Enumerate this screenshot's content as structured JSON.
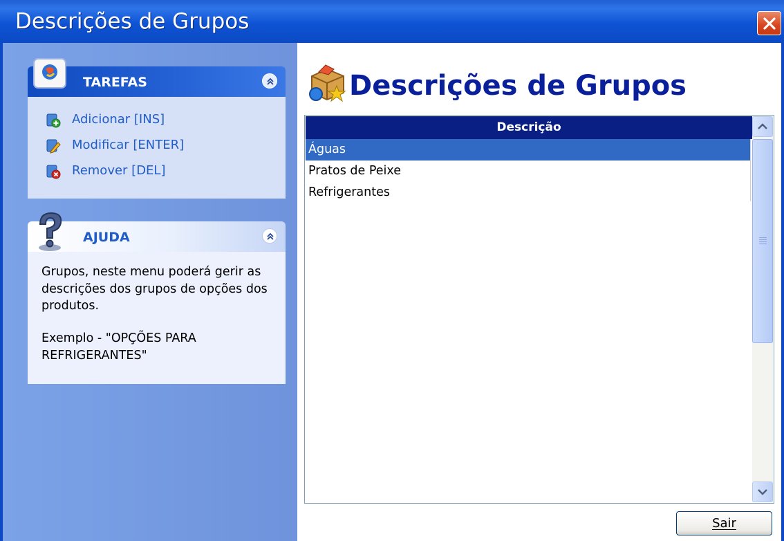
{
  "window": {
    "title": "Descrições de Grupos"
  },
  "main": {
    "title": "Descrições de Grupos"
  },
  "tasks_panel": {
    "title": "TAREFAS",
    "items": [
      {
        "label": "Adicionar [INS]",
        "icon": "add-icon"
      },
      {
        "label": "Modificar [ENTER]",
        "icon": "edit-icon"
      },
      {
        "label": "Remover [DEL]",
        "icon": "remove-icon"
      }
    ]
  },
  "help_panel": {
    "title": "AJUDA",
    "paragraph1": "Grupos, neste menu poderá gerir as descrições dos grupos de opções dos produtos.",
    "paragraph2": "Exemplo - \"OPÇÕES PARA REFRIGERANTES\""
  },
  "list": {
    "column_header": "Descrição",
    "rows": [
      {
        "label": "Águas",
        "selected": true
      },
      {
        "label": "Pratos de Peixe",
        "selected": false
      },
      {
        "label": "Refrigerantes",
        "selected": false
      }
    ]
  },
  "footer": {
    "exit_label": "Sair"
  },
  "colors": {
    "titlebar": "#0b4ac4",
    "selection": "#316ac5",
    "header": "#0a1f83",
    "link": "#215dc6"
  }
}
